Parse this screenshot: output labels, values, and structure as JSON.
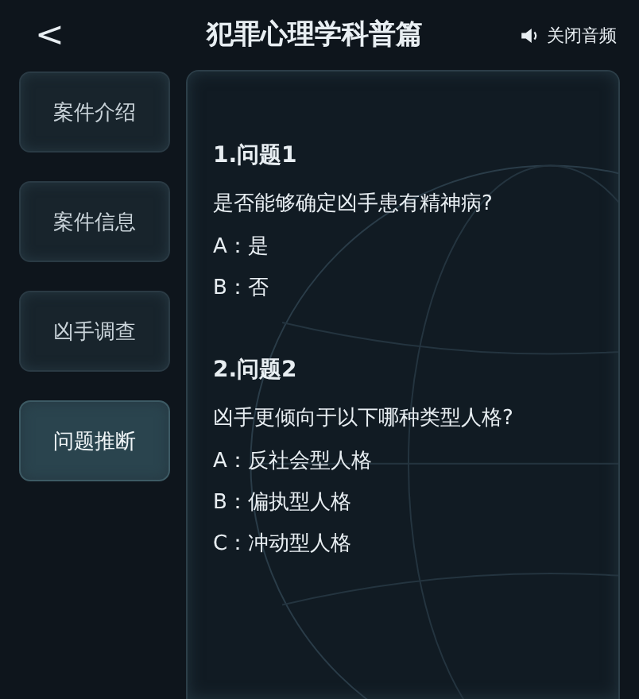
{
  "header": {
    "back": "<",
    "title": "犯罪心理学科普篇",
    "audio": "关闭音频"
  },
  "tabs": [
    {
      "label": "案件介绍",
      "selected": false
    },
    {
      "label": "案件信息",
      "selected": false
    },
    {
      "label": "凶手调查",
      "selected": false
    },
    {
      "label": "问题推断",
      "selected": true
    }
  ],
  "questions": [
    {
      "title": "1.问题1",
      "text": "是否能够确定凶手患有精神病?",
      "options": [
        "A：是",
        "B：否"
      ]
    },
    {
      "title": "2.问题2",
      "text": "凶手更倾向于以下哪种类型人格?",
      "options": [
        "A：反社会型人格",
        "B：偏执型人格",
        "C：冲动型人格"
      ]
    }
  ]
}
